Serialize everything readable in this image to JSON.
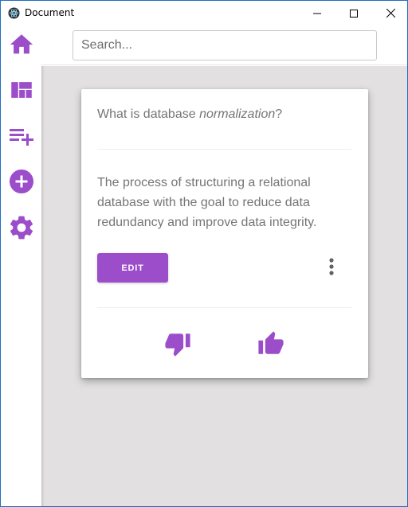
{
  "window": {
    "title": "Document"
  },
  "search": {
    "placeholder": "Search..."
  },
  "sidebar": {
    "items": [
      {
        "icon": "home-icon"
      },
      {
        "icon": "dashboard-icon"
      },
      {
        "icon": "playlist-add-icon"
      },
      {
        "icon": "add-circle-icon"
      },
      {
        "icon": "settings-icon"
      }
    ]
  },
  "card": {
    "question_prefix": "What is database ",
    "question_emphasis": "normalization",
    "question_suffix": "?",
    "answer": "The process of structuring a relational database with the goal to reduce data redundancy and improve data integrity.",
    "edit_label": "EDIT"
  },
  "colors": {
    "accent": "#9b4dca",
    "content_bg": "#e2e0e0",
    "text_muted": "#757575"
  }
}
